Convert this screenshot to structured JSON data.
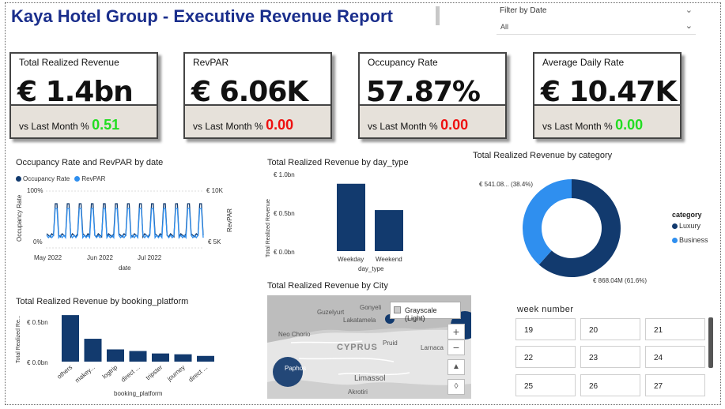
{
  "header": {
    "title": "Kaya Hotel Group - Executive Revenue Report"
  },
  "filter": {
    "label": "Filter by Date",
    "value": "All"
  },
  "kpis": [
    {
      "label": "Total Realized Revenue",
      "value": "€ 1.4bn",
      "foot": "vs Last Month %",
      "delta": "0.51",
      "delta_color": "#22dd22"
    },
    {
      "label": "RevPAR",
      "value": "€ 6.06K",
      "foot": "vs Last Month %",
      "delta": "0.00",
      "delta_color": "#ee1111"
    },
    {
      "label": "Occupancy Rate",
      "value": "57.87%",
      "foot": "vs Last Month %",
      "delta": "0.00",
      "delta_color": "#ee1111"
    },
    {
      "label": "Average Daily Rate",
      "value": "€ 10.47K",
      "foot": "vs Last Month %",
      "delta": "0.00",
      "delta_color": "#22dd22"
    }
  ],
  "colors": {
    "primary": "#123a6e",
    "secondary": "#2f8fef",
    "title": "#1a2e8c"
  },
  "occ_chart": {
    "title": "Occupancy Rate and RevPAR by date",
    "legend": [
      "Occupancy Rate",
      "RevPAR"
    ],
    "y_left_ticks": [
      "100%",
      "0%"
    ],
    "y_right_ticks": [
      "€ 10K",
      "€ 5K"
    ],
    "x_ticks": [
      "May 2022",
      "Jun 2022",
      "Jul 2022"
    ],
    "xlabel": "date",
    "ylabel_left": "Occupancy Rate",
    "ylabel_right": "RevPAR"
  },
  "day_chart": {
    "title": "Total Realized Revenue by day_type",
    "y_ticks": [
      "€ 1.0bn",
      "€ 0.5bn",
      "€ 0.0bn"
    ],
    "ylabel": "Total Realized Revenue",
    "xlabel": "day_type",
    "categories": [
      "Weekday",
      "Weekend"
    ]
  },
  "cat_chart": {
    "title": "Total Realized Revenue by category",
    "legend_title": "category",
    "labels": [
      "Luxury",
      "Business"
    ],
    "label_top": "€ 541.08... (38.4%)",
    "label_bottom": "€ 868.04M (61.6%)"
  },
  "plat_chart": {
    "title": "Total Realized Revenue by booking_platform",
    "y_ticks": [
      "€ 0.5bn",
      "€ 0.0bn"
    ],
    "ylabel": "Total Realized Re...",
    "xlabel": "booking_platform",
    "categories": [
      "others",
      "makey...",
      "logtrip",
      "direct ...",
      "tripster",
      "journey",
      "direct ..."
    ]
  },
  "map": {
    "title": "Total Realized Revenue by City",
    "style_label": "Grayscale (Light)",
    "places": [
      "Gonyeli",
      "Guzelyurt",
      "Lakatamela",
      "Neo Chorio",
      "CYPRUS",
      "Pruid",
      "Larnaca",
      "Paphos",
      "Limassol",
      "Akrotiri"
    ]
  },
  "weeks": {
    "title": "week number",
    "items": [
      "19",
      "20",
      "21",
      "22",
      "23",
      "24",
      "25",
      "26",
      "27"
    ]
  },
  "chart_data": [
    {
      "type": "bar",
      "title": "Total Realized Revenue by day_type",
      "categories": [
        "Weekday",
        "Weekend"
      ],
      "values": [
        0.87,
        0.53
      ],
      "ylabel": "Total Realized Revenue",
      "xlabel": "day_type",
      "ylim": [
        0,
        1.0
      ],
      "unit": "€ bn"
    },
    {
      "type": "pie",
      "title": "Total Realized Revenue by category",
      "categories": [
        "Luxury",
        "Business"
      ],
      "values": [
        868.04,
        541.08
      ],
      "percent": [
        61.6,
        38.4
      ],
      "unit": "€ M"
    },
    {
      "type": "bar",
      "title": "Total Realized Revenue by booking_platform",
      "categories": [
        "others",
        "makey...",
        "logtrip",
        "direct ...",
        "tripster",
        "journey",
        "direct ..."
      ],
      "values": [
        0.57,
        0.28,
        0.15,
        0.13,
        0.1,
        0.09,
        0.07
      ],
      "ylabel": "Total Realized Re...",
      "xlabel": "booking_platform",
      "ylim": [
        0,
        0.6
      ],
      "unit": "€ bn"
    }
  ]
}
